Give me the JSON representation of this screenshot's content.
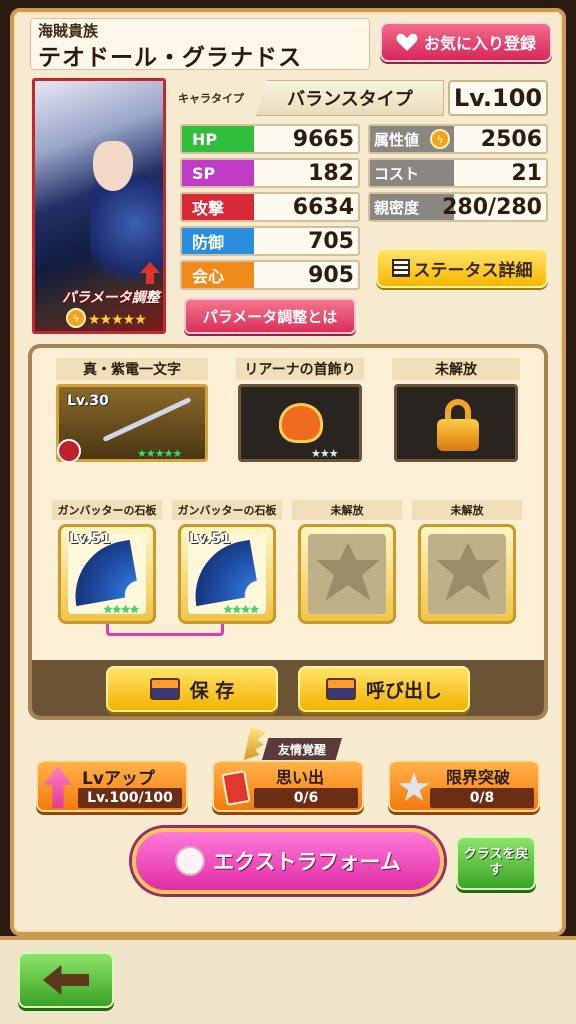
{
  "header": {
    "subtitle": "海賊貴族",
    "name": "テオドール・グラナドス",
    "favorite_label": "お気に入り登録"
  },
  "portrait": {
    "badge_label": "パラメータ調整",
    "stars": "★★★★★",
    "bolt": "ϟ"
  },
  "chara_type": {
    "label": "キャラタイプ",
    "value": "バランスタイプ",
    "level": "Lv.100"
  },
  "stats_left": [
    {
      "label": "HP",
      "value": "9665",
      "color": "#2fbf3a"
    },
    {
      "label": "SP",
      "value": "182",
      "color": "#c03cc6"
    },
    {
      "label": "攻撃",
      "value": "6634",
      "color": "#d82a36"
    },
    {
      "label": "防御",
      "value": "705",
      "color": "#2a8ee0"
    },
    {
      "label": "会心",
      "value": "905",
      "color": "#f08a1a"
    }
  ],
  "stats_right": [
    {
      "label": "属性値",
      "value": "2506",
      "bolt": "ϟ"
    },
    {
      "label": "コスト",
      "value": "21"
    },
    {
      "label": "親密度",
      "value": "280/280"
    }
  ],
  "status_detail_label": "ステータス詳細",
  "param_button_label": "パラメータ調整とは",
  "equipment": {
    "weapon": {
      "label": "真・紫電一文字",
      "level": "Lv.30",
      "stars": "★★★★★"
    },
    "accessory": {
      "label": "リアーナの首飾り",
      "stars": "★★★"
    },
    "locked": {
      "label": "未解放"
    }
  },
  "plates": [
    {
      "label": "ガンバッターの石板",
      "level": "Lv.51",
      "stars": "★★★★"
    },
    {
      "label": "ガンバッターの石板",
      "level": "Lv.51",
      "stars": "★★★★"
    },
    {
      "label": "未解放"
    },
    {
      "label": "未解放"
    }
  ],
  "actions": {
    "save": "保 存",
    "load": "呼び出し"
  },
  "bottom": {
    "lvup_title": "Lvアップ",
    "lvup_value": "Lv.100/100",
    "friend_tag": "友情覚醒",
    "memory_title": "思い出",
    "memory_value": "0/6",
    "limit_title": "限界突破",
    "limit_value": "0/8",
    "extra_form": "エクストラフォーム",
    "class_back": "クラスを戻す"
  }
}
